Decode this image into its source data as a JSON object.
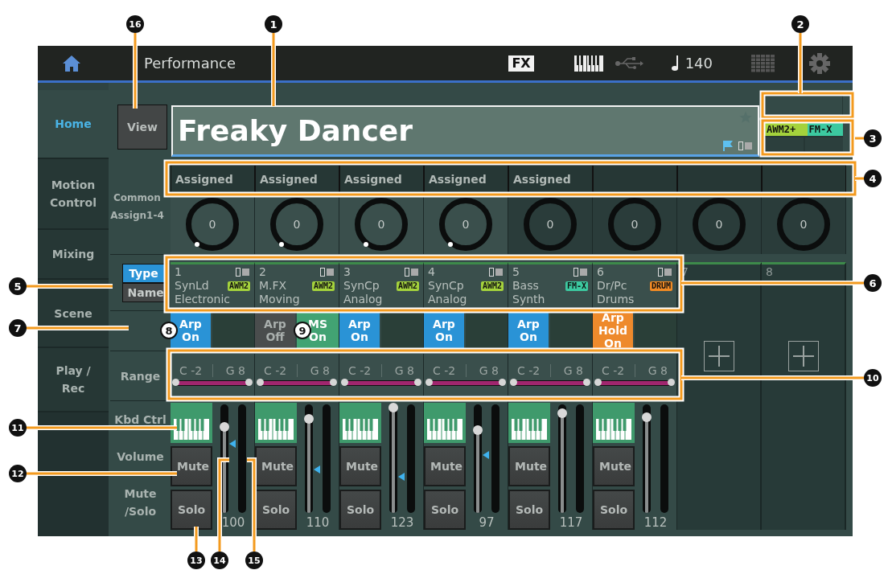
{
  "header": {
    "title": "Performance",
    "fx": "FX",
    "tempo": "140"
  },
  "tabs": [
    {
      "label": "Home",
      "selected": true
    },
    {
      "label": "Motion Control",
      "selected": false
    },
    {
      "label": "Mixing",
      "selected": false
    },
    {
      "label": "Scene",
      "selected": false
    },
    {
      "label": "Play / Rec",
      "selected": false
    }
  ],
  "view_button": "View",
  "performance_name": "Freaky Dancer",
  "engine_badge": {
    "left": "AWM2+",
    "right": "FM-X"
  },
  "common_assign": {
    "label": "Common Assign1-4",
    "knobs": [
      {
        "label": "Assigned",
        "value": "0",
        "active": true
      },
      {
        "label": "Assigned",
        "value": "0",
        "active": true
      },
      {
        "label": "Assigned",
        "value": "0",
        "active": true
      },
      {
        "label": "Assigned",
        "value": "0",
        "active": true
      },
      {
        "label": "Assigned",
        "value": "0",
        "active": false
      },
      {
        "value": "0",
        "active": false
      },
      {
        "value": "0",
        "active": false
      },
      {
        "value": "0",
        "active": false
      }
    ]
  },
  "display_toggle": [
    {
      "label": "Type",
      "selected": true
    },
    {
      "label": "Name",
      "selected": false
    }
  ],
  "row_labels": {
    "range": "Range",
    "kbd_ctrl": "Kbd Ctrl",
    "volume": "Volume",
    "mute_solo": "Mute /Solo"
  },
  "parts": [
    {
      "number": "1",
      "category": "SynLd",
      "name": "Electronic",
      "engine": {
        "label": "AWM2",
        "kind": "awm2"
      },
      "arp": {
        "label": "Arp On",
        "on": true,
        "hold": false
      },
      "range_low": "C -2",
      "range_high": "G 8",
      "kbd_ctrl": true,
      "mute": "Mute",
      "solo": "Solo",
      "fader": {
        "level": 0.79
      },
      "marker": {
        "level": 0.64
      },
      "volume": "100"
    },
    {
      "number": "2",
      "category": "M.FX",
      "name": "Moving",
      "engine": {
        "label": "AWM2",
        "kind": "awm2"
      },
      "arp": {
        "label": "Arp Off",
        "on": false,
        "hold": false
      },
      "ms": {
        "label": "MS On"
      },
      "range_low": "C -2",
      "range_high": "G 8",
      "kbd_ctrl": true,
      "mute": "Mute",
      "solo": "Solo",
      "fader": {
        "level": 0.87
      },
      "marker": {
        "level": 0.4
      },
      "volume": "110"
    },
    {
      "number": "3",
      "category": "SynCp",
      "name": "Analog",
      "engine": {
        "label": "AWM2",
        "kind": "awm2"
      },
      "arp": {
        "label": "Arp On",
        "on": true,
        "hold": false
      },
      "range_low": "C -2",
      "range_high": "G 8",
      "kbd_ctrl": true,
      "mute": "Mute",
      "solo": "Solo",
      "fader": {
        "level": 0.97
      },
      "marker": {
        "level": 0.33
      },
      "volume": "123"
    },
    {
      "number": "4",
      "category": "SynCp",
      "name": "Analog",
      "engine": {
        "label": "AWM2",
        "kind": "awm2"
      },
      "arp": {
        "label": "Arp On",
        "on": true,
        "hold": false
      },
      "range_low": "C -2",
      "range_high": "G 8",
      "kbd_ctrl": true,
      "mute": "Mute",
      "solo": "Solo",
      "fader": {
        "level": 0.76
      },
      "marker": {
        "level": 0.53
      },
      "volume": "97"
    },
    {
      "number": "5",
      "category": "Bass",
      "name": "Synth",
      "engine": {
        "label": "FM-X",
        "kind": "fmx"
      },
      "arp": {
        "label": "Arp On",
        "on": true,
        "hold": false
      },
      "range_low": "C -2",
      "range_high": "G 8",
      "kbd_ctrl": true,
      "mute": "Mute",
      "solo": "Solo",
      "fader": {
        "level": 0.92
      },
      "volume": "117"
    },
    {
      "number": "6",
      "category": "Dr/Pc",
      "name": "Drums",
      "engine": {
        "label": "DRUM",
        "kind": "drum"
      },
      "arp": {
        "label": "Arp Hold On",
        "on": true,
        "hold": true
      },
      "range_low": "C -2",
      "range_high": "G 8",
      "kbd_ctrl": true,
      "mute": "Mute",
      "solo": "Solo",
      "fader": {
        "level": 0.88
      },
      "volume": "112"
    }
  ],
  "empty_parts": [
    {
      "number": "7"
    },
    {
      "number": "8"
    }
  ],
  "callouts": [
    {
      "number": "16",
      "kind": "leader"
    },
    {
      "number": "1",
      "kind": "leader"
    },
    {
      "number": "2",
      "kind": "leader"
    },
    {
      "number": "3",
      "kind": "leader"
    },
    {
      "number": "4",
      "kind": "leader"
    },
    {
      "number": "5",
      "kind": "leader"
    },
    {
      "number": "6",
      "kind": "leader"
    },
    {
      "number": "7",
      "kind": "leader"
    },
    {
      "number": "8",
      "kind": "inline"
    },
    {
      "number": "9",
      "kind": "inline"
    },
    {
      "number": "10",
      "kind": "leader"
    },
    {
      "number": "11",
      "kind": "leader"
    },
    {
      "number": "12",
      "kind": "leader"
    },
    {
      "number": "13",
      "kind": "leader"
    },
    {
      "number": "14",
      "kind": "leader"
    },
    {
      "number": "15",
      "kind": "leader"
    }
  ]
}
